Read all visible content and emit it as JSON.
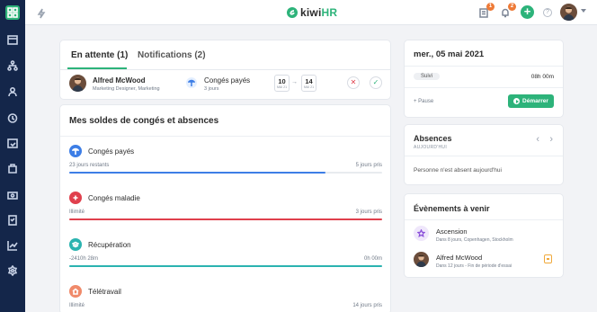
{
  "topbar": {
    "logo": {
      "kiwi": "kiwi",
      "hr": "HR"
    },
    "approvals_badge": "1",
    "notifications_badge": "2",
    "plus": "+",
    "help": "?"
  },
  "pending": {
    "tabs": {
      "pending": "En attente (1)",
      "notifications": "Notifications (2)"
    },
    "request": {
      "name": "Alfred McWood",
      "role": "Marketing Designer, Marketing",
      "type": "Congés payés",
      "days": "3 jours",
      "start_day": "10",
      "start_month": "MAI 21",
      "end_day": "14",
      "end_month": "MAI 21",
      "arrow": "→",
      "reject": "✕",
      "approve": "✓"
    }
  },
  "balances": {
    "title": "Mes soldes de congés et absences",
    "items": [
      {
        "name": "Congés payés",
        "left": "23 jours restants",
        "taken": "5 jours pris",
        "fill": 0.82,
        "color": "#3d7ee6"
      },
      {
        "name": "Congés maladie",
        "left": "Illimité",
        "taken": "3 jours pris",
        "fill": 1.0,
        "color": "#e0404d"
      },
      {
        "name": "Récupération",
        "left": "-2410h 28m",
        "taken": "0h 00m",
        "fill": 1.0,
        "color": "#2bb3b0"
      },
      {
        "name": "Télétravail",
        "left": "Illimité",
        "taken": "14 jours pris",
        "fill": 1.0,
        "color": "#f08a6a"
      }
    ]
  },
  "day": {
    "title": "mer., 05 mai 2021",
    "status": "Suivi",
    "hours": "08h 00m",
    "pause": "+ Pause",
    "start_label": "Démarrer"
  },
  "absences": {
    "title": "Absences",
    "subtitle": "AUJOURD'HUI",
    "prev": "‹",
    "next": "›",
    "empty": "Personne n'est absent aujourd'hui"
  },
  "events": {
    "title": "Évènements à venir",
    "items": [
      {
        "name": "Ascension",
        "desc": "Dans 8 jours, Copenhagen, Stockholm"
      },
      {
        "name": "Alfred McWood",
        "desc": "Dans 12 jours - Fin de période d'essai"
      }
    ]
  }
}
